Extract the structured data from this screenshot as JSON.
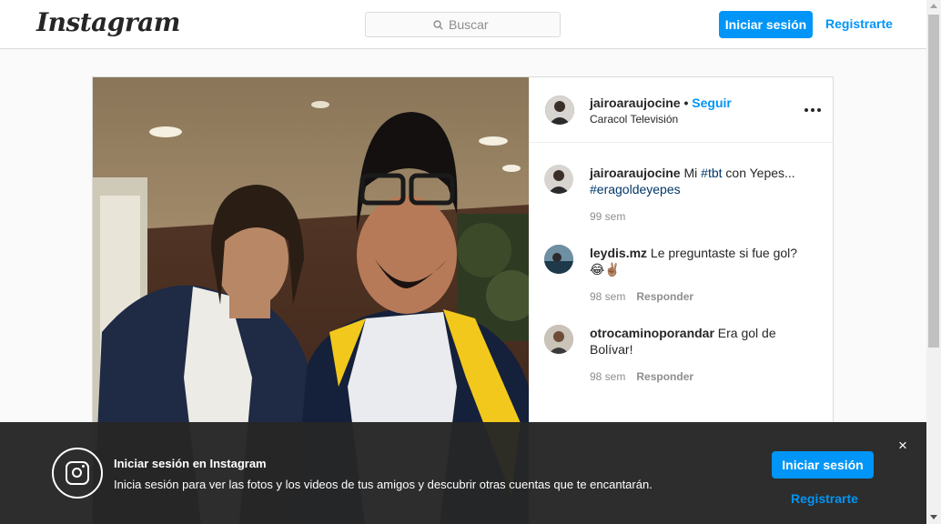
{
  "header": {
    "logo": "Instagram",
    "search_placeholder": "Buscar",
    "login_label": "Iniciar sesión",
    "register_label": "Registrarte"
  },
  "post": {
    "author": {
      "username": "jairoaraujocine",
      "separator": "•",
      "follow_label": "Seguir",
      "location": "Caracol Televisión"
    },
    "comments": [
      {
        "username": "jairoaraujocine",
        "text_before": "Mi ",
        "tag1": "#tbt",
        "text_after": " con Yepes...",
        "tag2": "#eragoldeyepes",
        "time": "99 sem",
        "reply_label": ""
      },
      {
        "username": "leydis.mz",
        "text": "Le preguntaste si fue gol?",
        "emoji": "😂✌🏽",
        "time": "98 sem",
        "reply_label": "Responder"
      },
      {
        "username": "otrocaminoporandar",
        "text": "Era gol de Bolívar!",
        "time": "98 sem",
        "reply_label": "Responder"
      }
    ]
  },
  "banner": {
    "title": "Iniciar sesión en Instagram",
    "subtitle": "Inicia sesión para ver las fotos y los videos de tus amigos y descubrir otras cuentas que te encantarán.",
    "login_label": "Iniciar sesión",
    "register_label": "Registrarte",
    "close_glyph": "×"
  },
  "colors": {
    "accent": "#0095f6",
    "tag": "#00376b",
    "muted": "#8e8e8e",
    "banner_bg": "#262626"
  },
  "icons": [
    "search-icon",
    "more-options-icon",
    "instagram-glyph-icon",
    "close-icon"
  ]
}
